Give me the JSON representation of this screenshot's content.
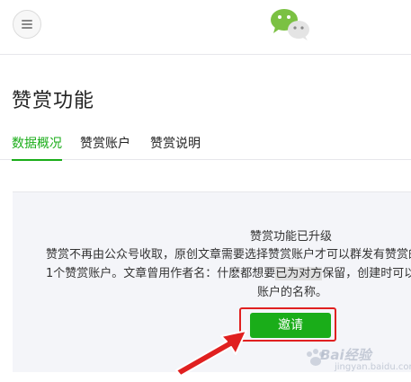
{
  "header": {
    "menu_icon": "hamburger-icon",
    "logo_icon": "wechat-logo-icon"
  },
  "page_title": "赞赏功能",
  "tabs": [
    {
      "label": "数据概况",
      "active": true
    },
    {
      "label": "赞赏账户",
      "active": false
    },
    {
      "label": "赞赏说明",
      "active": false
    }
  ],
  "notice": {
    "title": "赞赏功能已升级",
    "line1": "赞赏不再由公众号收取，原创文章需要选择赞赏账户才可以群发有赞赏的",
    "line2_a": "1个赞赏账户。文章曾用作者名：什麽都想要",
    "line2_hl": "已为对方",
    "line2_b": "保留，创建时可以",
    "line3": "账户的名称。"
  },
  "invite_button": {
    "label": "邀请"
  },
  "annotation": {
    "arrow_icon": "red-arrow-icon",
    "highlight_color": "#e02020"
  },
  "watermark": {
    "text": "Bai经验",
    "sub": "jingyan.baidu.com"
  },
  "colors": {
    "accent": "#1aad19",
    "panel_bg": "#f4f5f9"
  }
}
